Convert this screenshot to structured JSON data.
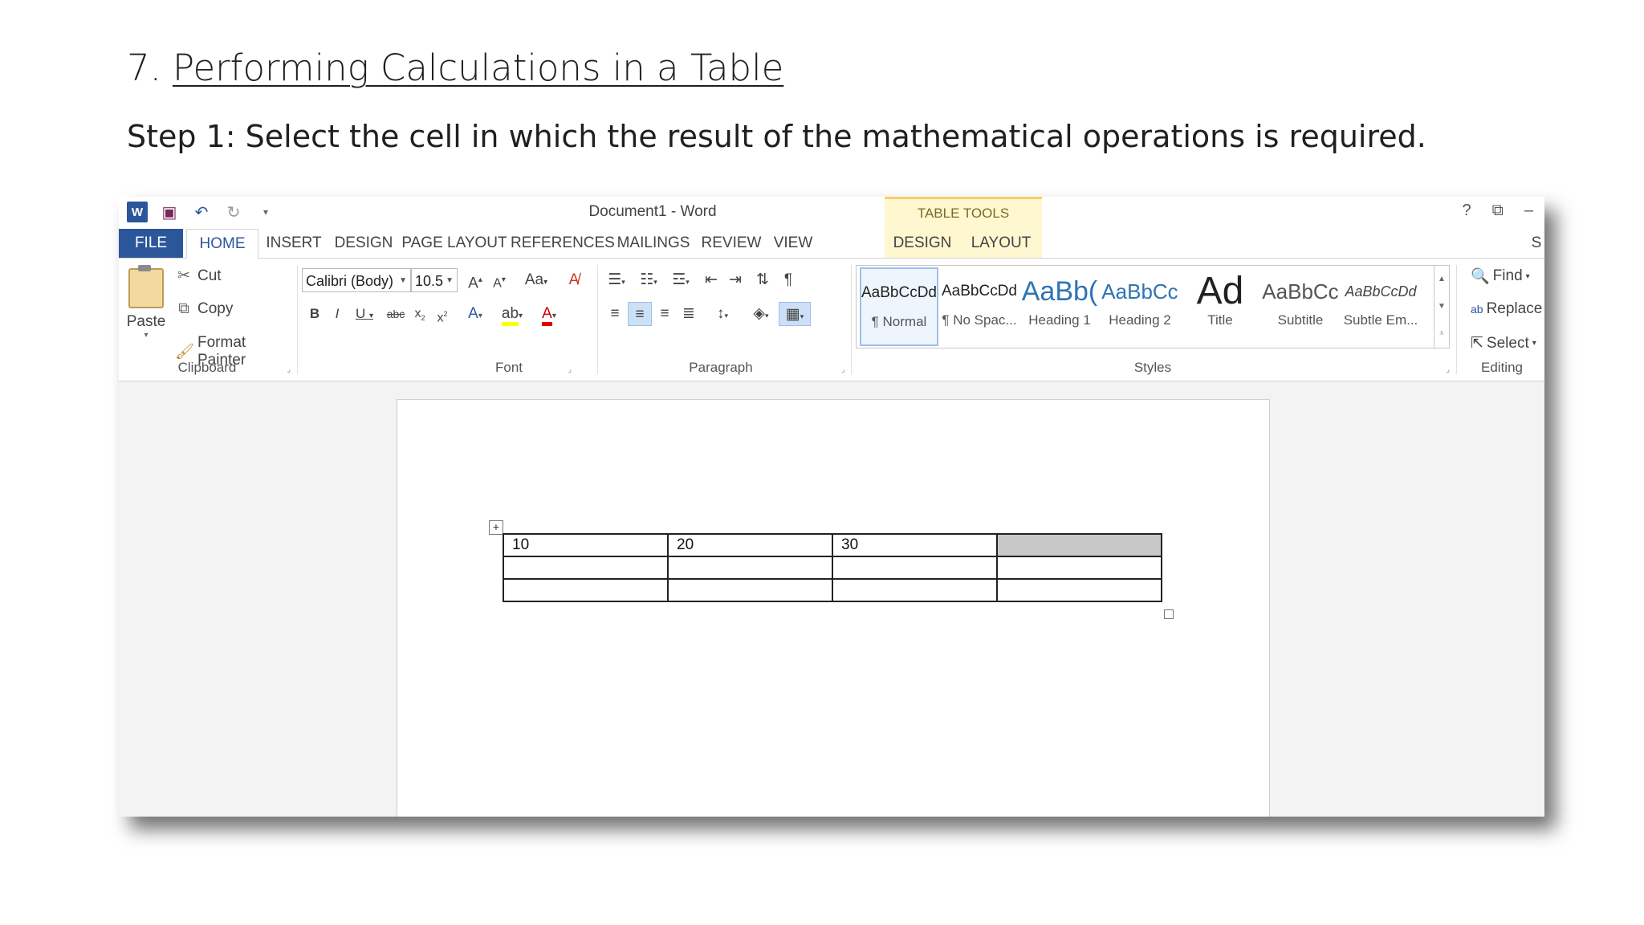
{
  "slide": {
    "number": "7.",
    "title": "Performing Calculations in a Table",
    "step": "Step 1: Select the cell in which the result of the mathematical operations is required."
  },
  "window": {
    "title": "Document1 - Word",
    "contextual_header": "TABLE TOOLS",
    "controls": [
      "?",
      "⧉",
      "–"
    ]
  },
  "tabs": [
    "FILE",
    "HOME",
    "INSERT",
    "DESIGN",
    "PAGE LAYOUT",
    "REFERENCES",
    "MAILINGS",
    "REVIEW",
    "VIEW",
    "DESIGN",
    "LAYOUT",
    "S"
  ],
  "clipboard": {
    "paste": "Paste",
    "cut": "Cut",
    "copy": "Copy",
    "format_painter": "Format Painter",
    "label": "Clipboard"
  },
  "font": {
    "family": "Calibri (Body)",
    "size": "10.5",
    "label": "Font"
  },
  "paragraph": {
    "label": "Paragraph"
  },
  "styles": {
    "label": "Styles",
    "items": [
      {
        "preview": "AaBbCcDd",
        "name": "¶ Normal"
      },
      {
        "preview": "AaBbCcDd",
        "name": "¶ No Spac..."
      },
      {
        "preview": "AaBb(",
        "name": "Heading 1"
      },
      {
        "preview": "AaBbCc",
        "name": "Heading 2"
      },
      {
        "preview": "Ad",
        "name": "Title"
      },
      {
        "preview": "AaBbCc",
        "name": "Subtitle"
      },
      {
        "preview": "AaBbCcDd",
        "name": "Subtle Em..."
      }
    ]
  },
  "editing": {
    "find": "Find",
    "replace": "Replace",
    "select": "Select",
    "label": "Editing"
  },
  "table": {
    "rows": [
      [
        "10",
        "20",
        "30",
        ""
      ],
      [
        "",
        "",
        "",
        ""
      ],
      [
        "",
        "",
        "",
        ""
      ]
    ],
    "selected_cell": "row 1, column 4"
  }
}
